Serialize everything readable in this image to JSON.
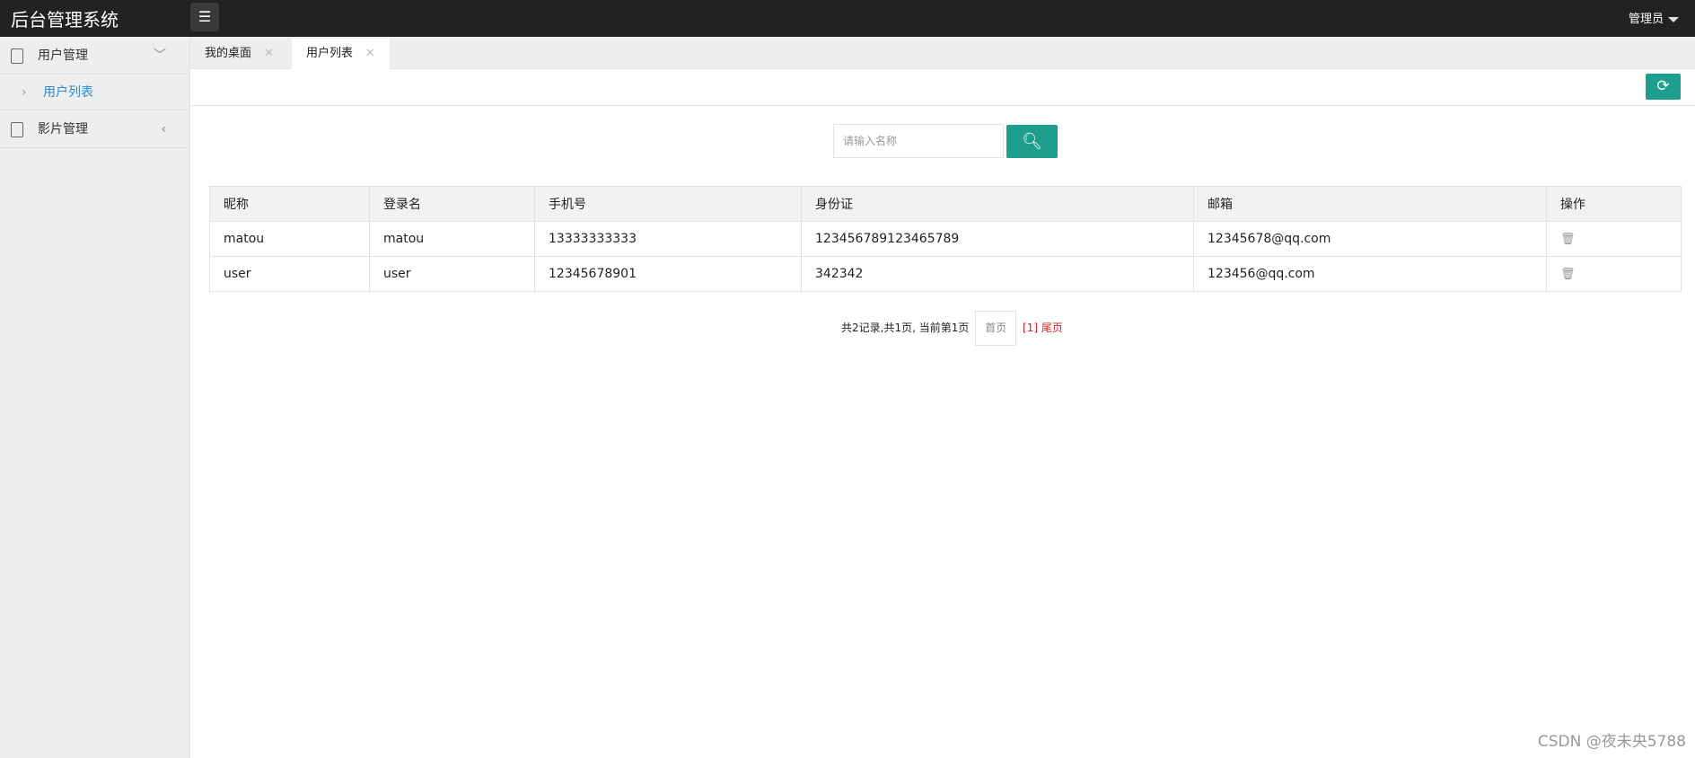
{
  "header": {
    "title": "后台管理系统",
    "user": "管理员"
  },
  "sidebar": {
    "items": [
      {
        "label": "用户管理",
        "children": [
          {
            "label": "用户列表"
          }
        ]
      },
      {
        "label": "影片管理"
      }
    ]
  },
  "tabs": [
    {
      "label": "我的桌面"
    },
    {
      "label": "用户列表"
    }
  ],
  "search": {
    "placeholder": "请输入名称"
  },
  "table": {
    "headers": [
      "昵称",
      "登录名",
      "手机号",
      "身份证",
      "邮箱",
      "操作"
    ],
    "rows": [
      [
        "matou",
        "matou",
        "13333333333",
        "123456789123465789",
        "12345678@qq.com"
      ],
      [
        "user",
        "user",
        "12345678901",
        "342342",
        "123456@qq.com"
      ]
    ]
  },
  "pager": {
    "summary": "共2记录,共1页, 当前第1页",
    "first": "首页",
    "current": "[1]",
    "last": "尾页"
  },
  "watermark": "CSDN @夜未央5788",
  "colors": {
    "accent": "#1e9f8e",
    "header": "#222222"
  }
}
